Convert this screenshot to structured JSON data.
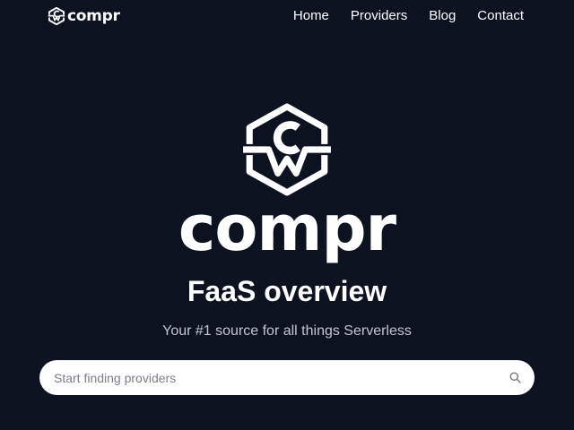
{
  "brand": {
    "name": "compr",
    "logo_icon": "compr-hexagon-logo"
  },
  "nav": {
    "items": [
      {
        "label": "Home"
      },
      {
        "label": "Providers"
      },
      {
        "label": "Blog"
      },
      {
        "label": "Contact"
      }
    ]
  },
  "hero": {
    "logo_icon": "compr-hexagon-logo",
    "wordmark": "compr",
    "title": "FaaS overview",
    "subtitle": "Your #1 source for all things Serverless"
  },
  "search": {
    "placeholder": "Start finding providers",
    "value": "",
    "icon": "search-icon"
  },
  "colors": {
    "background": "#0c1220",
    "text": "#ffffff",
    "subtitle": "#c3c6cd",
    "search_bg": "#ffffff"
  }
}
